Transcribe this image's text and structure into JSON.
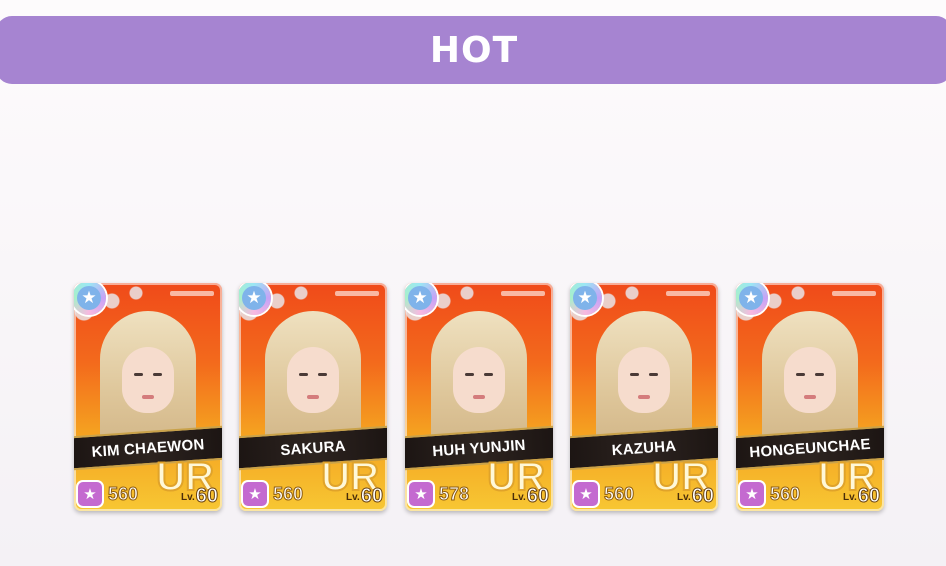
{
  "header": {
    "title": "HOT",
    "color": "#a684d1"
  },
  "cards": [
    {
      "name": "KIM CHAEWON",
      "rarity": "UR",
      "power": "560",
      "level_label": "Lv.",
      "level": "60",
      "badge_icon": "star-icon"
    },
    {
      "name": "SAKURA",
      "rarity": "UR",
      "power": "560",
      "level_label": "Lv.",
      "level": "60",
      "badge_icon": "star-icon"
    },
    {
      "name": "HUH YUNJIN",
      "rarity": "UR",
      "power": "578",
      "level_label": "Lv.",
      "level": "60",
      "badge_icon": "star-icon"
    },
    {
      "name": "KAZUHA",
      "rarity": "UR",
      "power": "560",
      "level_label": "Lv.",
      "level": "60",
      "badge_icon": "star-icon"
    },
    {
      "name": "HONGEUNCHAE",
      "rarity": "UR",
      "power": "560",
      "level_label": "Lv.",
      "level": "60",
      "badge_icon": "star-icon"
    }
  ]
}
